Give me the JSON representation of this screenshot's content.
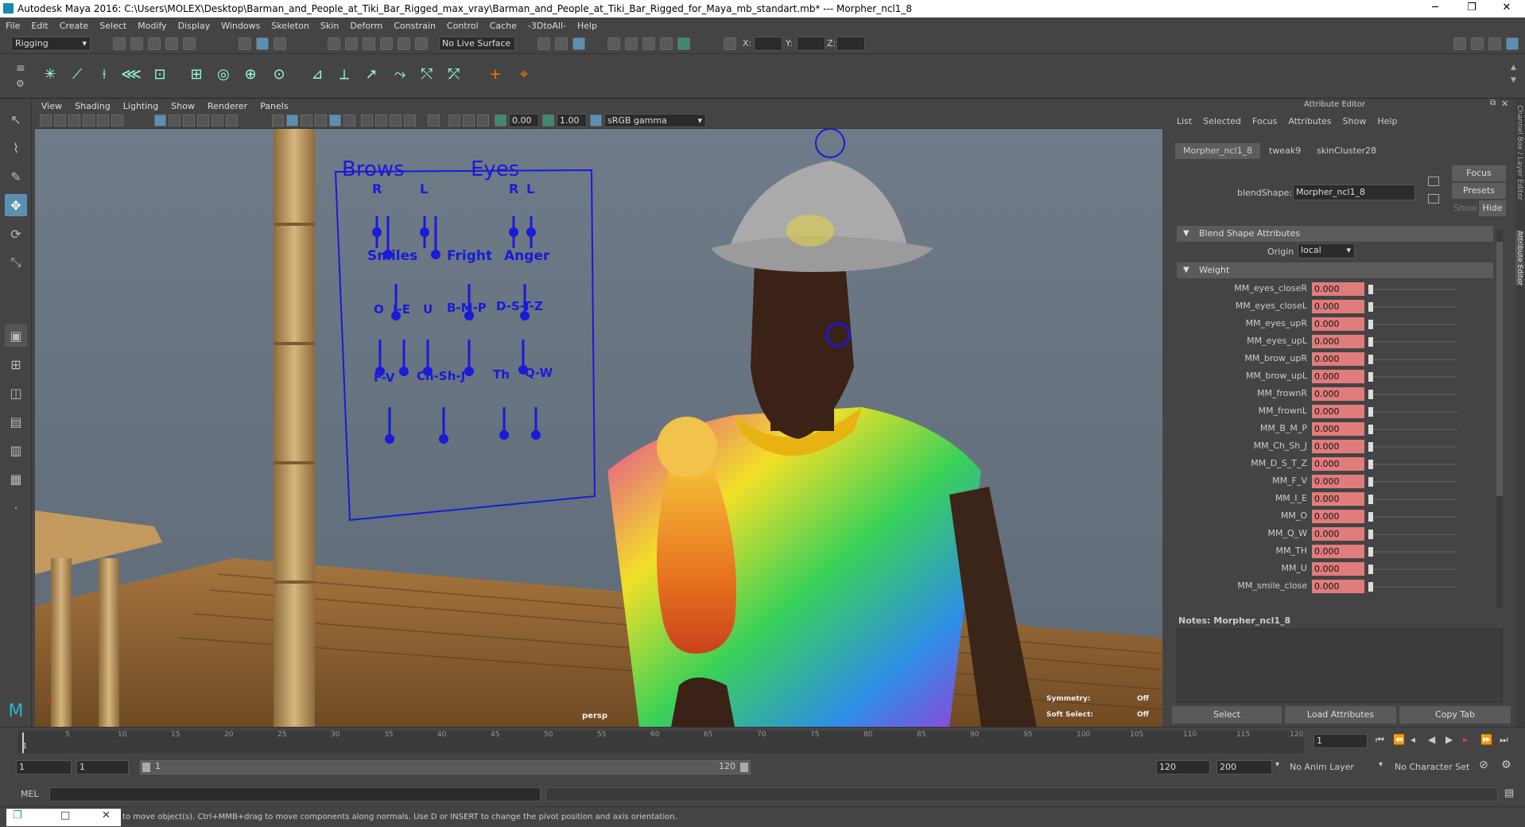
{
  "window": {
    "title": "Autodesk Maya 2016: C:\\Users\\MOLEX\\Desktop\\Barman_and_People_at_Tiki_Bar_Rigged_max_vray\\Barman_and_People_at_Tiki_Bar_Rigged_for_Maya_mb_standart.mb*   ---   Morpher_ncl1_8",
    "minimize": "─",
    "maximize": "❐",
    "close": "✕"
  },
  "menu": [
    "File",
    "Edit",
    "Create",
    "Select",
    "Modify",
    "Display",
    "Windows",
    "Skeleton",
    "Skin",
    "Deform",
    "Constrain",
    "Control",
    "Cache",
    "-3DtoAll-",
    "Help"
  ],
  "status": {
    "mode": "Rigging",
    "live_surface": "No Live Surface",
    "x_label": "X:",
    "y_label": "Y:",
    "z_label": "Z:"
  },
  "viewport": {
    "menu": [
      "View",
      "Shading",
      "Lighting",
      "Show",
      "Renderer",
      "Panels"
    ],
    "gamma_value_1": "0.00",
    "gamma_value_2": "1.00",
    "color_space": "sRGB gamma",
    "camera": "persp",
    "symmetry_label": "Symmetry:",
    "symmetry_value": "Off",
    "soft_select_label": "Soft Select:",
    "soft_select_value": "Off",
    "face_panel": {
      "brows": "Brows",
      "eyes": "Eyes",
      "r1": "R",
      "l1": "L",
      "r2": "R",
      "l2": "L",
      "smiles": "Smiles",
      "fright": "Fright",
      "anger": "Anger",
      "o": "O",
      "ie": "I-E",
      "u": "U",
      "bmp": "B-M-P",
      "dstz": "D-S-T-Z",
      "fv": "F-V",
      "chshj": "Ch-Sh-J",
      "th": "Th",
      "qw": "Q-W"
    }
  },
  "attribute_editor": {
    "title": "Attribute Editor",
    "menu": [
      "List",
      "Selected",
      "Focus",
      "Attributes",
      "Show",
      "Help"
    ],
    "tabs": [
      "Morpher_ncl1_8",
      "tweak9",
      "skinCluster28"
    ],
    "blendshape_label": "blendShape:",
    "blendshape_value": "Morpher_ncl1_8",
    "focus_btn": "Focus",
    "presets_btn": "Presets",
    "show_btn": "Show",
    "hide_btn": "Hide",
    "section_blend": "Blend Shape Attributes",
    "origin_label": "Origin",
    "origin_value": "local",
    "section_weight": "Weight",
    "weights": [
      {
        "name": "MM_eyes_closeR",
        "value": "0.000"
      },
      {
        "name": "MM_eyes_closeL",
        "value": "0.000"
      },
      {
        "name": "MM_eyes_upR",
        "value": "0.000"
      },
      {
        "name": "MM_eyes_upL",
        "value": "0.000"
      },
      {
        "name": "MM_brow_upR",
        "value": "0.000"
      },
      {
        "name": "MM_brow_upL",
        "value": "0.000"
      },
      {
        "name": "MM_frownR",
        "value": "0.000"
      },
      {
        "name": "MM_frownL",
        "value": "0.000"
      },
      {
        "name": "MM_B_M_P",
        "value": "0.000"
      },
      {
        "name": "MM_Ch_Sh_J",
        "value": "0.000"
      },
      {
        "name": "MM_D_S_T_Z",
        "value": "0.000"
      },
      {
        "name": "MM_F_V",
        "value": "0.000"
      },
      {
        "name": "MM_I_E",
        "value": "0.000"
      },
      {
        "name": "MM_O",
        "value": "0.000"
      },
      {
        "name": "MM_Q_W",
        "value": "0.000"
      },
      {
        "name": "MM_TH",
        "value": "0.000"
      },
      {
        "name": "MM_U",
        "value": "0.000"
      },
      {
        "name": "MM_smile_close",
        "value": "0.000"
      }
    ],
    "notes_label": "Notes:  Morpher_ncl1_8",
    "select_btn": "Select",
    "load_btn": "Load Attributes",
    "copy_btn": "Copy Tab",
    "side_tab_1": "Channel Box / Layer Editor",
    "side_tab_2": "Attribute Editor"
  },
  "timeline": {
    "ticks": [
      "5",
      "10",
      "15",
      "20",
      "25",
      "30",
      "35",
      "40",
      "45",
      "50",
      "55",
      "60",
      "65",
      "70",
      "75",
      "80",
      "85",
      "90",
      "95",
      "100",
      "105",
      "110",
      "115",
      "120"
    ],
    "first_tick": "1",
    "current_frame": "1",
    "range_start": "1",
    "range_start2": "1",
    "range_slider_start": "1",
    "range_slider_end": "120",
    "range_end": "120",
    "anim_end": "200",
    "anim_layer": "No Anim Layer",
    "char_set": "No Character Set"
  },
  "command": {
    "mel_label": "MEL",
    "help_text": "to move object(s). Ctrl+MMB+drag to move components along normals. Use D or INSERT to change the pivot position and axis orientation."
  }
}
